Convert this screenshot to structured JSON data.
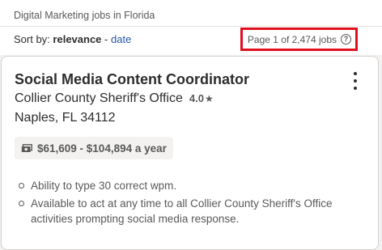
{
  "header": {
    "search_description": "Digital Marketing jobs in Florida",
    "sort": {
      "prefix": "Sort by:",
      "current": "relevance",
      "separator": "-",
      "alternate": "date"
    },
    "result_count": "Page 1 of 2,474 jobs",
    "help_icon": "question-circle-icon",
    "highlight_color": "#e0101f"
  },
  "job": {
    "title": "Social Media Content Coordinator",
    "company": "Collier County Sheriff's Office",
    "rating": "4.0",
    "rating_icon": "star-icon",
    "location": "Naples, FL 34112",
    "salary": "$61,609 - $104,894 a year",
    "salary_icon": "money-icon",
    "menu_icon": "kebab-menu-icon",
    "snippet": [
      "Ability to type 30 correct wpm.",
      "Available to act at any time to all Collier County Sheriff's Office activities prompting social media response."
    ]
  },
  "colors": {
    "link": "#2557a7",
    "text": "#2d2d2d",
    "muted": "#595959",
    "background": "#f3f2f1"
  }
}
